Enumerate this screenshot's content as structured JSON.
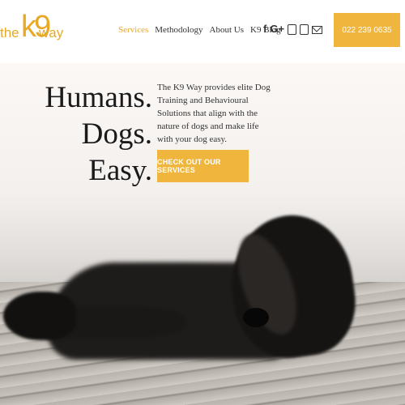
{
  "logo": {
    "the": "the",
    "k9": "k9",
    "way": "way"
  },
  "nav": [
    {
      "label": "Services",
      "active": true
    },
    {
      "label": "Methodology",
      "active": false
    },
    {
      "label": "About Us",
      "active": false
    },
    {
      "label": "K9 Blog",
      "active": false
    }
  ],
  "social": {
    "facebook": "f",
    "googleplus": "G+",
    "instagram": "instagram-icon",
    "youtube": "youtube-icon",
    "email": "email-icon"
  },
  "phone": "022 239 0635",
  "hero": {
    "headline": [
      "Humans.",
      "Dogs.",
      "Easy."
    ],
    "description": "The K9 Way provides elite Dog Training and Behavioural Solutions that align with the nature of dogs and make life with your dog easy.",
    "cta": "CHECK OUT OUR SERVICES"
  },
  "colors": {
    "accent": "#f0b53d"
  }
}
